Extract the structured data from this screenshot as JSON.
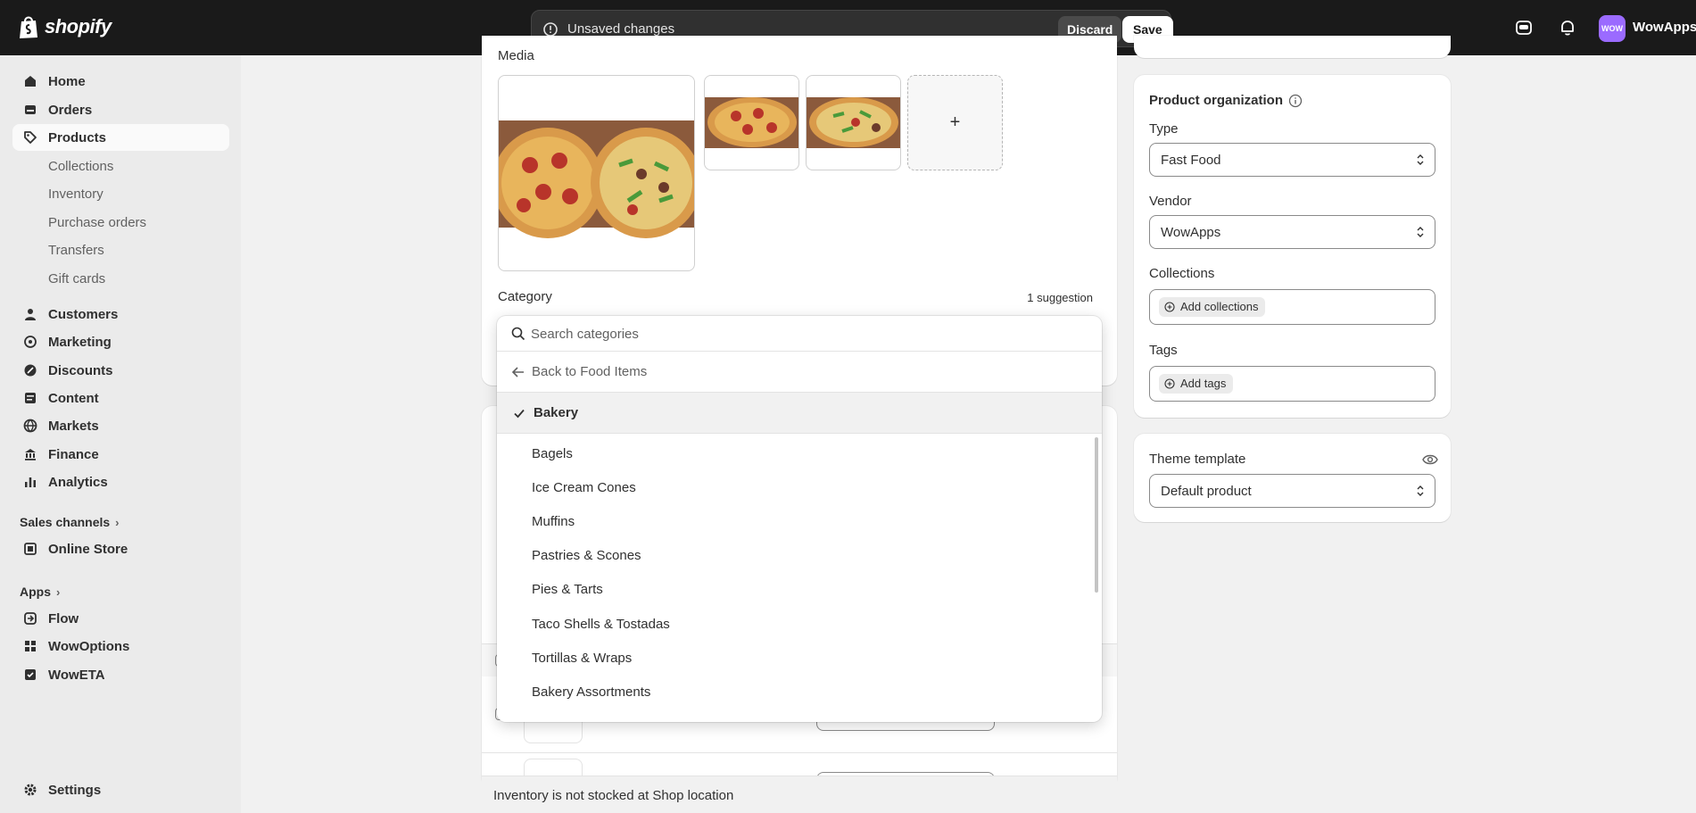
{
  "topbar": {
    "logo_text": "shopify",
    "unsaved_message": "Unsaved changes",
    "discard_label": "Discard",
    "save_label": "Save",
    "store_avatar_text": "WOW",
    "store_name": "WowApps"
  },
  "sidebar": {
    "items": [
      {
        "label": "Home",
        "icon": "home-icon"
      },
      {
        "label": "Orders",
        "icon": "orders-icon"
      },
      {
        "label": "Products",
        "icon": "tag-icon"
      }
    ],
    "product_subitems": [
      "Collections",
      "Inventory",
      "Purchase orders",
      "Transfers",
      "Gift cards"
    ],
    "items2": [
      {
        "label": "Customers",
        "icon": "person-icon"
      },
      {
        "label": "Marketing",
        "icon": "target-icon"
      },
      {
        "label": "Discounts",
        "icon": "discount-icon"
      },
      {
        "label": "Content",
        "icon": "content-icon"
      },
      {
        "label": "Markets",
        "icon": "globe-icon"
      },
      {
        "label": "Finance",
        "icon": "bank-icon"
      },
      {
        "label": "Analytics",
        "icon": "chart-icon"
      }
    ],
    "sales_channels_label": "Sales channels",
    "online_store": "Online Store",
    "apps_label": "Apps",
    "apps": [
      "Flow",
      "WowOptions",
      "WowETA"
    ],
    "settings": "Settings"
  },
  "main": {
    "media_label": "Media",
    "add_media_symbol": "+",
    "category_label": "Category",
    "suggestion": "1 suggestion",
    "inventory_notice": "Inventory is not stocked at Shop location"
  },
  "category_dropdown": {
    "search_placeholder": "Search categories",
    "back_label": "Back to Food Items",
    "selected": "Bakery",
    "options": [
      "Bagels",
      "Ice Cream Cones",
      "Muffins",
      "Pastries & Scones",
      "Pies & Tarts",
      "Taco Shells & Tostadas",
      "Tortillas & Wraps",
      "Bakery Assortments"
    ]
  },
  "organization": {
    "title": "Product organization",
    "type_label": "Type",
    "type_value": "Fast Food",
    "vendor_label": "Vendor",
    "vendor_value": "WowApps",
    "collections_label": "Collections",
    "add_collections": "Add collections",
    "tags_label": "Tags",
    "add_tags": "Add tags"
  },
  "theme": {
    "label": "Theme template",
    "value": "Default product"
  }
}
